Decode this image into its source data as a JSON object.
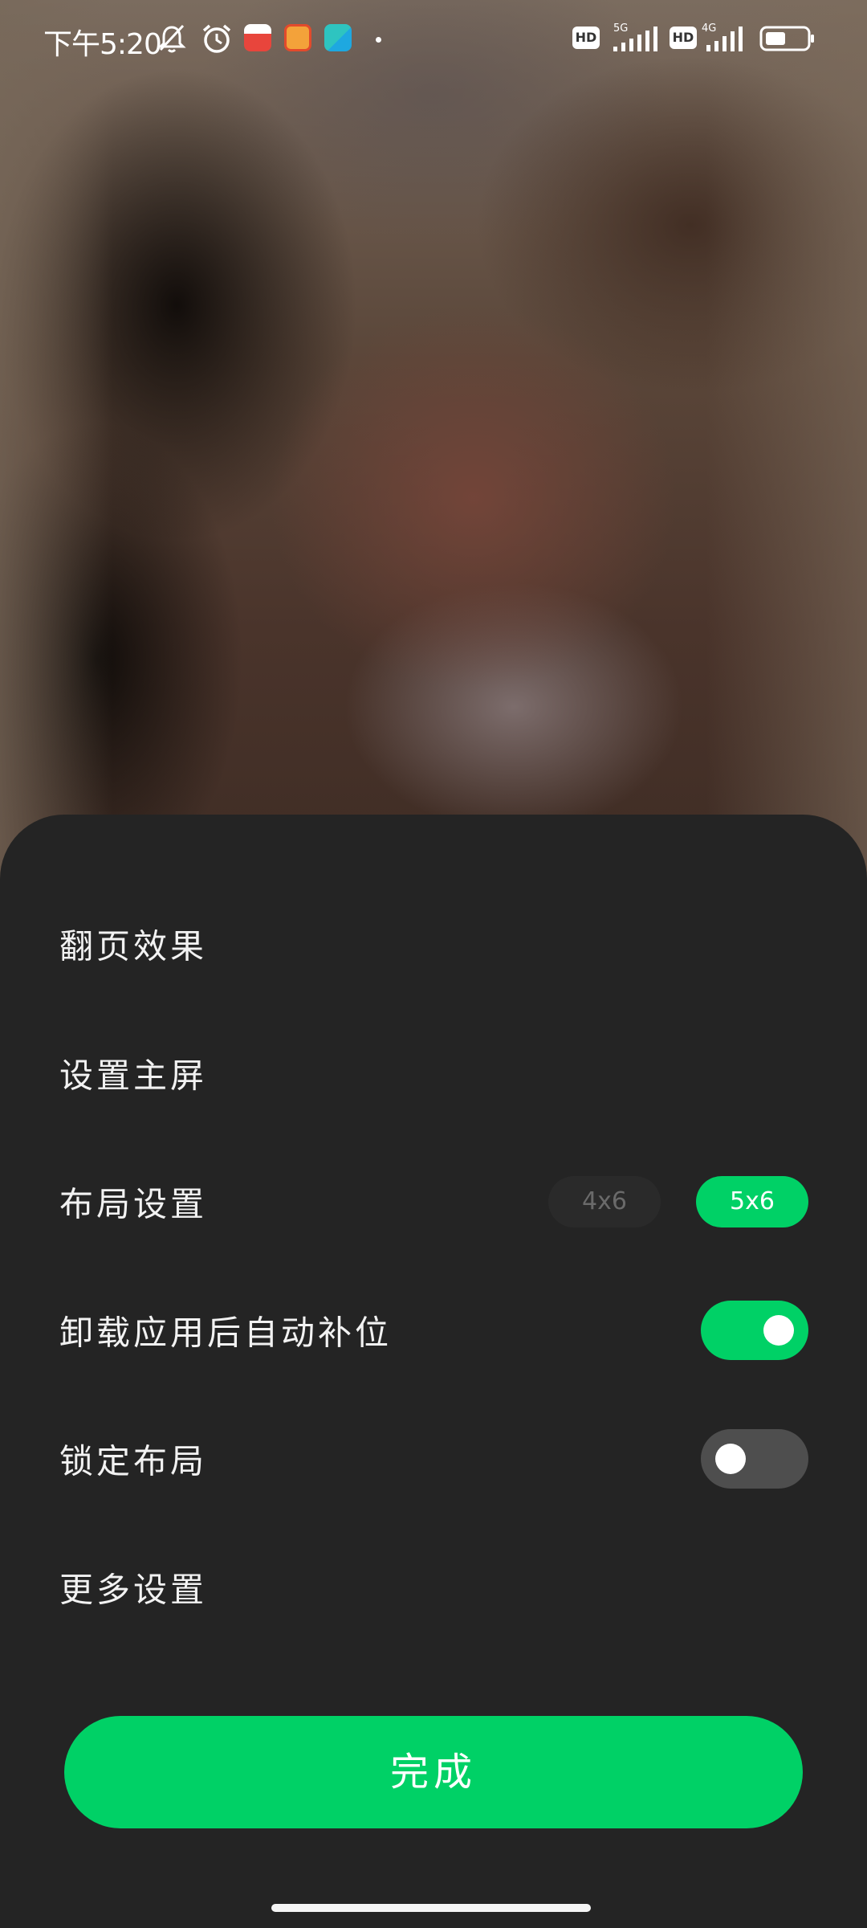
{
  "status_bar": {
    "time": "下午5:20",
    "signal_1_label": "5G",
    "signal_2_label": "4G",
    "hd_label": "HD"
  },
  "settings": {
    "page_effect": "翻页效果",
    "set_home": "设置主屏",
    "layout": {
      "label": "布局设置",
      "options": [
        "4x6",
        "5x6"
      ],
      "selected": "5x6"
    },
    "auto_fill": {
      "label": "卸载应用后自动补位",
      "enabled": true
    },
    "lock_layout": {
      "label": "锁定布局",
      "enabled": false
    },
    "more": "更多设置"
  },
  "done_label": "完成",
  "colors": {
    "accent": "#00d166",
    "sheet_bg": "#242424",
    "toggle_off": "#4e4e4e"
  }
}
